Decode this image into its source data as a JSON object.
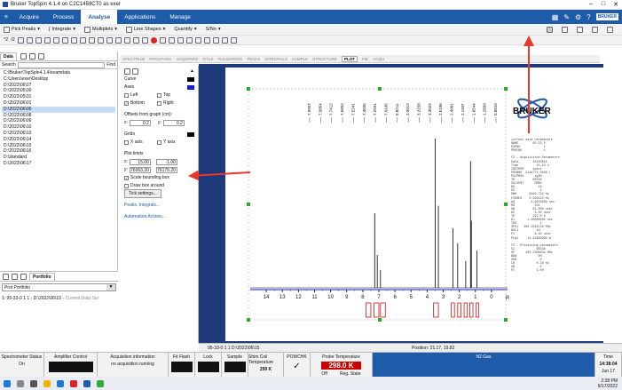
{
  "window": {
    "title": "Bruker TopSpin 4.1.4 on C2C1459CT0 as exer"
  },
  "menu": {
    "tabs": [
      "Acquire",
      "Process",
      "Analyse",
      "Applications",
      "Manage"
    ],
    "active": "Analyse",
    "brand": "BRUKER"
  },
  "toolbar1": {
    "items": [
      "Pick Peaks",
      "Integrate",
      "Multiplets",
      "Line Shapes",
      "Quantify",
      "S/No"
    ]
  },
  "toolbar2": {
    "scale": "*2",
    "scale2": "/2"
  },
  "left_tabs": [
    "Data",
    "Portfolio"
  ],
  "search_label": "Search",
  "find_label": "Find",
  "tree": [
    "C:\\Bruker\\TopSpin4.1.4\\examdata",
    "C:\\Users\\exer\\Desktop",
    "D:\\2022\\06\\27",
    "D:\\2022\\05\\30",
    "D:\\2022\\05\\31",
    "D:\\2022\\06\\01",
    "D:\\2022\\06\\06",
    "D:\\2022\\06\\08",
    "D:\\2022\\06\\09",
    "D:\\2022\\06\\10",
    "D:\\2022\\06\\13",
    "D:\\2022\\06\\14",
    "D:\\2022\\06\\15",
    "D:\\2022\\06\\16",
    "D:\\standard",
    "D:\\2022\\06\\17"
  ],
  "tree_selected": 6,
  "portfolio": {
    "tab": "Portfolio",
    "selector": "Prot Portfolio",
    "row": "1: 95-33-0 1 1 - D:\\2022\\06\\15",
    "row_note": " - Current Data Set"
  },
  "view_tabs": [
    "SPECTRUM",
    "PROCPARS",
    "ACQUPARS",
    "TITLE",
    "PULSEPROG",
    "PEAKS",
    "INTEGRALS",
    "SAMPLE",
    "STRUCTURE",
    "PLOT",
    "FID",
    "ACQU"
  ],
  "view_active": "PLOT",
  "props": {
    "curve": "Curve",
    "axes": "Axes",
    "left": "Left",
    "top": "Top",
    "bottom": "Bottom",
    "right": "Right",
    "offsets_label": "Offsets from graph (cm):",
    "offx": "0.2",
    "offy": "0.2",
    "grids": "Grids",
    "xaxis": "X axis",
    "yaxis": "Y axis",
    "plot_limits": "Plot limits",
    "x1": "15.00",
    "x2": "-1.00",
    "y1": "76063.20",
    "y2": "76179.20",
    "scale_bb": "Scale bounding box",
    "draw_box": "Draw box around",
    "tick_settings": "Tick settings...",
    "peaks_link": "Peaks, Integrals...",
    "auto_link": "Automation Actions..."
  },
  "spectrum": {
    "axis_ticks": [
      "14",
      "13",
      "12",
      "11",
      "10",
      "9",
      "8",
      "7",
      "6",
      "5",
      "4",
      "3",
      "2",
      "1",
      "0"
    ],
    "unit": "ppm",
    "xlim": [
      15,
      -1
    ],
    "peaks": [
      [
        7.26,
        0.5
      ],
      [
        7.1,
        0.22
      ],
      [
        6.9,
        0.12
      ],
      [
        3.5,
        1.0
      ],
      [
        3.3,
        0.55
      ],
      [
        2.4,
        0.4
      ],
      [
        2.1,
        0.3
      ],
      [
        1.6,
        0.18
      ],
      [
        1.3,
        0.85
      ],
      [
        1.25,
        0.45
      ],
      [
        0.9,
        0.25
      ]
    ],
    "peak_labels": [
      "7.9997",
      "7.9854",
      "7.7412",
      "7.6852",
      "7.5241",
      "7.4035",
      "7.2591",
      "7.0145",
      "6.8211",
      "3.5012",
      "3.3158",
      "3.3022",
      "2.5106",
      "2.4001",
      "2.1187",
      "1.6544",
      "1.2899",
      "0.8810"
    ]
  },
  "bruker_logo": "BRUKER",
  "params_text": "Current Data Parameters\nNAME        95-33-0\nEXPNO             1\nPROCNO            1\n\nF2 - Acquisition Parameters\nDate_       20220615\nTime          15.24 h\nINSTRUM     spect\nPROBHD  Z144774_0049 (\nPULPROG      zg30\nTD          65536\nSOLVENT      DMSO\nNS             16\nDS              2\nSWH       8196.722 Hz\nFIDRES    0.250144 Hz\nAQ         3.9976959 sec\nRG           101\nDW          61.000 usec\nDE           6.50 usec\nTE          297.0 K\nD1       1.00000000 sec\nTD0             1\nSFO1   400.2324729 MHz\nNUC1          1H\nP1           8.40 usec\nPLW1     13.45999908 W\n\nF2 - Processing parameters\nSI            65536\nSF      400.2300034 MHz\nWDW            EM\nSSB             0\nLB            0.30 Hz\nGB              0\nPC            1.00",
  "statusbar": {
    "dataset": "95-33-0  1  1  D:\\2022\\06\\15",
    "position": "Position: 21.17, 19.82"
  },
  "instr": {
    "spectrometer": "Spectrometer Status",
    "spec_val": "On",
    "amplifier": "Amplifier Control",
    "acq": "Acquisition information",
    "acq_val": "no acquisition running",
    "fitflash": "Fit Flash",
    "lock": "Lock",
    "sample": "Sample",
    "shim": "Shim Coil Temperature",
    "shim_val": "299 K",
    "powchk": "POWCHK",
    "probe": "Probe Temperature",
    "probe_val": "298.0 K",
    "off": "Off",
    "reg": "Reg. State",
    "nitrogen": "N2 Gas",
    "time_label": "Time",
    "time_val": "14:38:04",
    "date_val": "Jun 17"
  },
  "taskbar": {
    "time": "2:38 PM",
    "date": "6/17/2022"
  },
  "colors": {
    "menu": "#1e5ba8",
    "canvas": "#1e3a7a",
    "accent": "#e8382a",
    "peak_label": "#d01010"
  }
}
